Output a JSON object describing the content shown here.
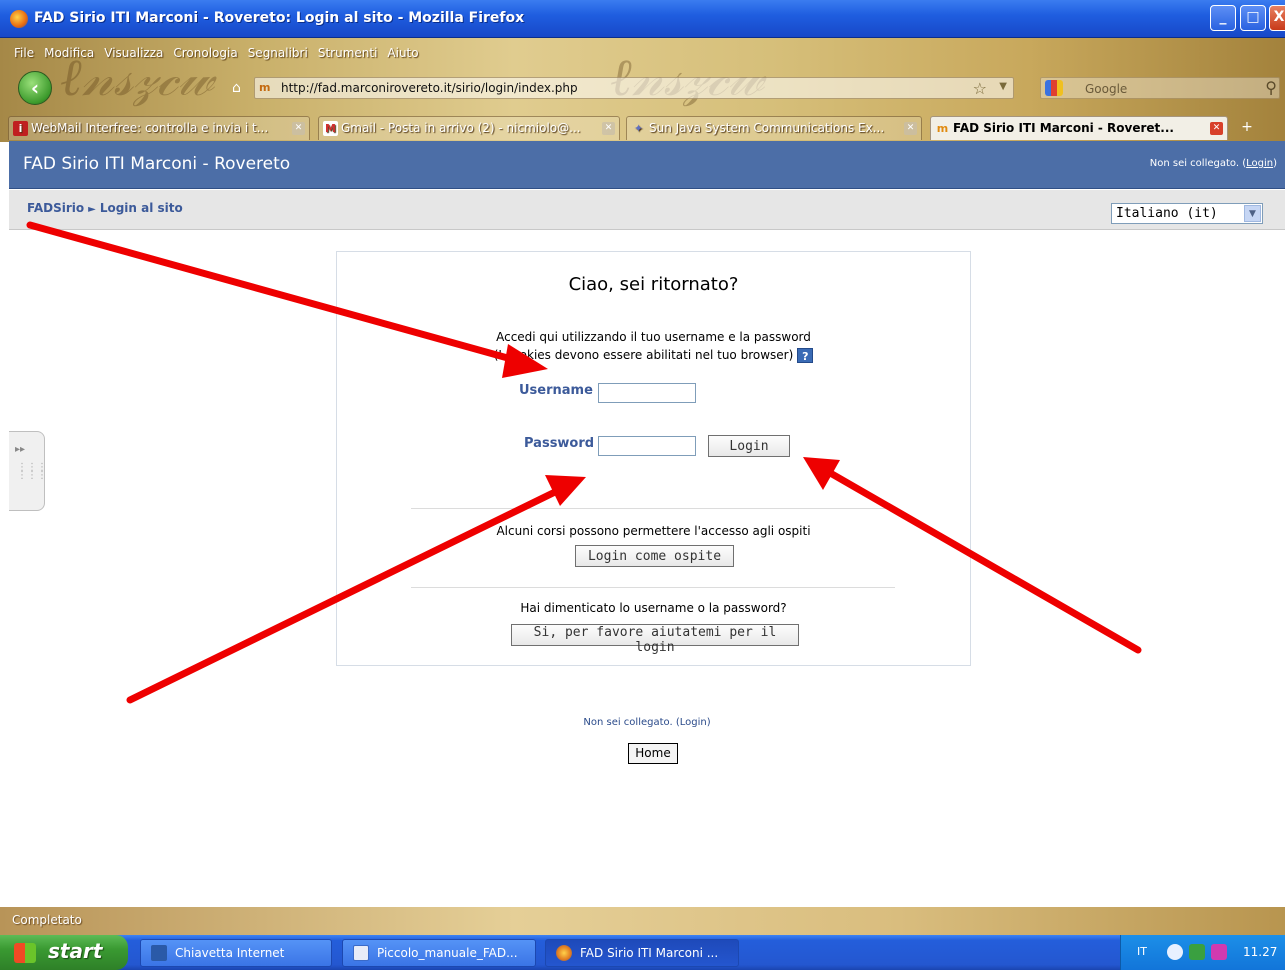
{
  "window": {
    "title": "FAD Sirio ITI Marconi - Rovereto: Login al sito - Mozilla Firefox",
    "buttons": {
      "minimize": "_",
      "maximize": "□",
      "close": "X"
    }
  },
  "menu": [
    "File",
    "Modifica",
    "Visualizza",
    "Cronologia",
    "Segnalibri",
    "Strumenti",
    "Aiuto"
  ],
  "nav": {
    "url": "http://fad.marconirovereto.it/sirio/login/index.php",
    "favicon": "m",
    "search_placeholder": "Google"
  },
  "tabs": [
    {
      "label": "WebMail Interfree: controlla e invia i t...",
      "icon": "webmail-icon",
      "color": "#c02020"
    },
    {
      "label": "Gmail - Posta in arrivo (2) - nicmiolo@...",
      "icon": "gmail-icon",
      "color": "#d03030"
    },
    {
      "label": "Sun Java System Communications Ex...",
      "icon": "sun-icon",
      "color": "#6070c0"
    },
    {
      "label": "FAD Sirio ITI Marconi - Roveret...",
      "icon": "moodle-icon",
      "color": "#e08a10",
      "active": true
    }
  ],
  "site": {
    "name": "FAD Sirio ITI Marconi - Rovereto",
    "login_info_prefix": "Non sei collegato. (",
    "login_info_link": "Login",
    "login_info_suffix": ")"
  },
  "breadcrumb": {
    "home": "FADSirio",
    "separator": "►",
    "current": "Login al sito"
  },
  "language": {
    "selected": "Italiano (it)"
  },
  "login": {
    "heading": "Ciao, sei ritornato?",
    "desc_line1": "Accedi qui utilizzando il tuo username e la password",
    "desc_line2": "(I cookies devono essere abilitati nel tuo browser)",
    "help": "?",
    "username_label": "Username",
    "username_value": "",
    "password_label": "Password",
    "password_value": "",
    "login_button": "Login",
    "guest_note": "Alcuni corsi possono permettere l'accesso agli ospiti",
    "guest_button": "Login come ospite",
    "forgot_note": "Hai dimenticato lo username o la password?",
    "forgot_button": "Si, per favore aiutatemi per il login"
  },
  "footer": {
    "login_info_prefix": "Non sei collegato. (",
    "login_info_link": "Login",
    "login_info_suffix": ")",
    "home_button": "Home"
  },
  "status": {
    "text": "Completato"
  },
  "taskbar": {
    "start": "start",
    "items": [
      {
        "label": "Chiavetta Internet",
        "color": "#2a5aa8"
      },
      {
        "label": "Piccolo_manuale_FAD...",
        "color": "#3a6ac8"
      },
      {
        "label": "FAD Sirio ITI Marconi ...",
        "color": "#e07a20",
        "active": true
      }
    ],
    "tray_lang": "IT",
    "clock": "11.27"
  },
  "colors": {
    "header_bg": "#4c6ea7",
    "label_blue": "#3c5a9a",
    "arrow_red": "#ee0000"
  }
}
